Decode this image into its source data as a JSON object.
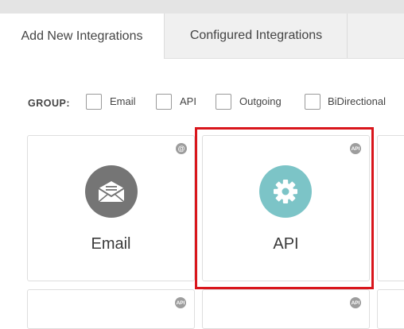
{
  "tabs": [
    {
      "label": "Add New Integrations"
    },
    {
      "label": "Configured Integrations"
    }
  ],
  "group": {
    "label": "GROUP:",
    "options": [
      {
        "label": "Email",
        "checked": false
      },
      {
        "label": "API",
        "checked": false
      },
      {
        "label": "Outgoing",
        "checked": false
      },
      {
        "label": "BiDirectional",
        "checked": false
      }
    ]
  },
  "cards": [
    {
      "label": "Email",
      "badge": "@",
      "icon": "envelope-icon",
      "icon_color": "#757575"
    },
    {
      "label": "API",
      "badge": "API",
      "icon": "gear-icon",
      "icon_color": "#7cc4c7"
    }
  ],
  "bottom_cards": [
    {
      "badge": "API"
    },
    {
      "badge": "API"
    }
  ],
  "colors": {
    "highlight": "#d9161c",
    "badge": "#9d9d9d"
  }
}
